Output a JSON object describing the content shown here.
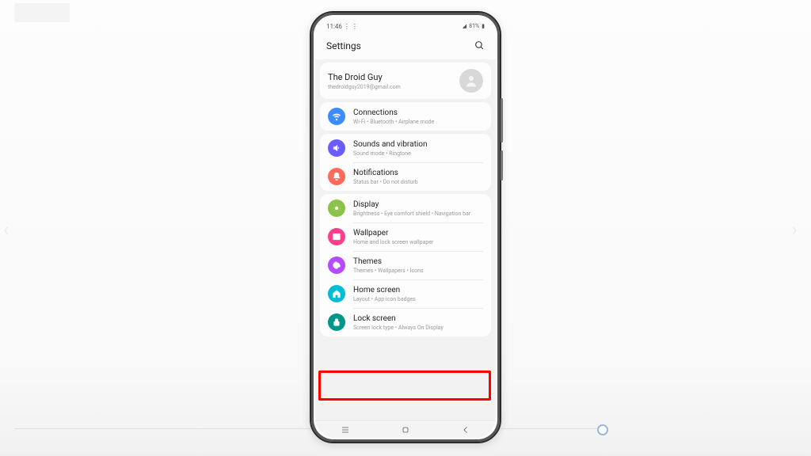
{
  "status": {
    "time": "11:46",
    "extra": "⋮ ⋮",
    "signal": "◢",
    "wifi": "⩓",
    "battery_pct": "81%",
    "battery_icon": "▮"
  },
  "header": {
    "title": "Settings"
  },
  "account": {
    "name": "The Droid Guy",
    "email": "thedroidguy2019@gmail.com"
  },
  "groups": [
    {
      "items": [
        {
          "id": "connections",
          "title": "Connections",
          "subtitle": "Wi-Fi • Bluetooth • Airplane mode",
          "color": "#3a8cff",
          "icon": "wifi"
        }
      ]
    },
    {
      "items": [
        {
          "id": "sounds",
          "title": "Sounds and vibration",
          "subtitle": "Sound mode • Ringtone",
          "color": "#6a5cff",
          "icon": "sound"
        },
        {
          "id": "notifications",
          "title": "Notifications",
          "subtitle": "Status bar • Do not disturb",
          "color": "#ff6b5b",
          "icon": "bell"
        }
      ]
    },
    {
      "items": [
        {
          "id": "display",
          "title": "Display",
          "subtitle": "Brightness • Eye comfort shield • Navigation bar",
          "color": "#8bc34a",
          "icon": "sun"
        },
        {
          "id": "wallpaper",
          "title": "Wallpaper",
          "subtitle": "Home and lock screen wallpaper",
          "color": "#ff3e8c",
          "icon": "picture"
        },
        {
          "id": "themes",
          "title": "Themes",
          "subtitle": "Themes • Wallpapers • Icons",
          "color": "#b54aff",
          "icon": "palette"
        },
        {
          "id": "homescreen",
          "title": "Home screen",
          "subtitle": "Layout • App icon badges",
          "color": "#00bcd4",
          "icon": "home"
        },
        {
          "id": "lockscreen",
          "title": "Lock screen",
          "subtitle": "Screen lock type • Always On Display",
          "color": "#009688",
          "icon": "lock"
        }
      ]
    }
  ],
  "highlighted_item": "themes"
}
